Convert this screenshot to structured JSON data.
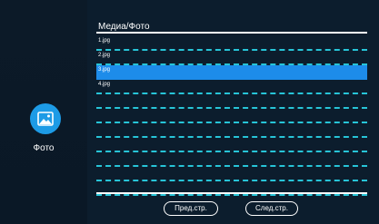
{
  "sidebar": {
    "label": "Фото",
    "icon": "image-icon"
  },
  "header": {
    "title": "Медиа/Фото"
  },
  "files": [
    {
      "name": "1.jpg",
      "selected": false
    },
    {
      "name": "2.jpg",
      "selected": false
    },
    {
      "name": "3.jpg",
      "selected": true
    },
    {
      "name": "4.jpg",
      "selected": false
    },
    {
      "name": "",
      "selected": false
    },
    {
      "name": "",
      "selected": false
    },
    {
      "name": "",
      "selected": false
    },
    {
      "name": "",
      "selected": false
    },
    {
      "name": "",
      "selected": false
    },
    {
      "name": "",
      "selected": false
    },
    {
      "name": "",
      "selected": false
    }
  ],
  "pagination": {
    "prev_label": "Пред.стр.",
    "next_label": "След.стр."
  },
  "colors": {
    "accent": "#1d8cea",
    "separator": "#27c5d8",
    "icon_bg": "#1d9be6"
  }
}
